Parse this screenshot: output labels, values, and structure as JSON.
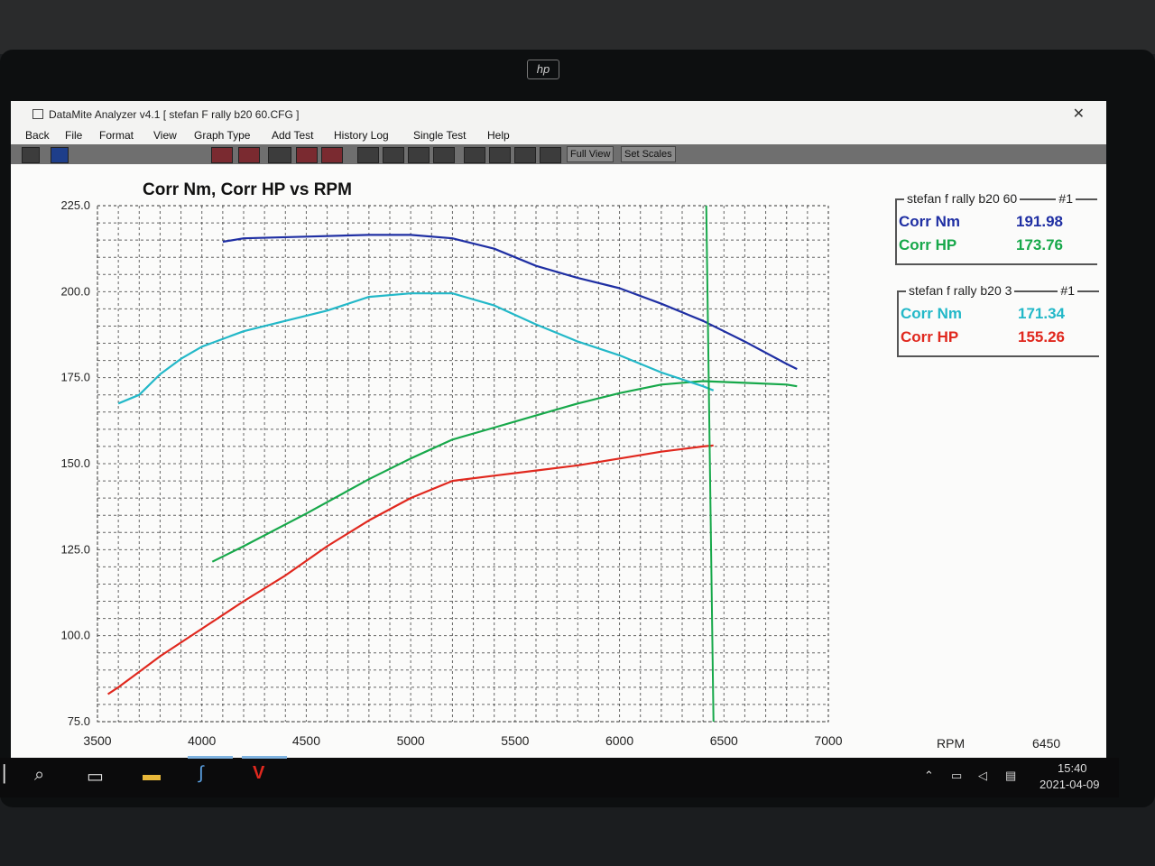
{
  "window": {
    "title": "DataMite Analyzer v4.1  [ stefan F rally b20 60.CFG ]",
    "close_glyph": "✕"
  },
  "menu": [
    "Back",
    "File",
    "Format",
    "View",
    "Graph Type",
    "Add Test",
    "History Log",
    "Single Test",
    "Help"
  ],
  "toolbar": {
    "full_view": "Full View",
    "set_scales": "Set Scales"
  },
  "legends": [
    {
      "title": "stefan f rally b20 60",
      "num": "#1",
      "rows": [
        {
          "label": "Corr Nm",
          "value": "191.98",
          "color": "#1f2fa3"
        },
        {
          "label": "Corr HP",
          "value": "173.76",
          "color": "#17a84a"
        }
      ]
    },
    {
      "title": "stefan f rally b20 3",
      "num": "#1",
      "rows": [
        {
          "label": "Corr Nm",
          "value": "171.34",
          "color": "#23b8c8"
        },
        {
          "label": "Corr HP",
          "value": "155.26",
          "color": "#e0281e"
        }
      ]
    }
  ],
  "cursor": {
    "label": "RPM",
    "value": "6450",
    "color": "#17a84a"
  },
  "taskbar": {
    "time": "15:40",
    "date": "2021-04-09"
  },
  "chart_data": {
    "type": "line",
    "title": "Corr Nm, Corr HP vs RPM",
    "xlabel": "RPM",
    "ylabel": "",
    "xlim": [
      3500,
      7000
    ],
    "ylim": [
      75,
      225
    ],
    "xticks": [
      "3500",
      "4000",
      "4500",
      "5000",
      "5500",
      "6000",
      "6500",
      "7000"
    ],
    "yticks": [
      "75.0",
      "100.0",
      "125.0",
      "150.0",
      "175.0",
      "200.0",
      "225.0"
    ],
    "grid": true,
    "series": [
      {
        "name": "Corr Nm",
        "color": "#1f2fa3",
        "x": [
          4100,
          4200,
          4500,
          4800,
          5000,
          5200,
          5400,
          5600,
          5800,
          6000,
          6200,
          6400,
          6600,
          6800,
          6850
        ],
        "y": [
          214.5,
          215.5,
          216,
          216.5,
          216.5,
          215.5,
          212.5,
          207.5,
          204,
          201,
          196.5,
          191.5,
          185.5,
          179,
          177.5
        ]
      },
      {
        "name": "Corr HP",
        "color": "#17a84a",
        "x": [
          4050,
          4200,
          4500,
          4800,
          5000,
          5200,
          5400,
          5600,
          5800,
          6000,
          6200,
          6400,
          6600,
          6800,
          6850
        ],
        "y": [
          121.5,
          126,
          135.5,
          145.5,
          151.5,
          157,
          160.5,
          164,
          167.5,
          170.5,
          173,
          174,
          173.5,
          173,
          172.5
        ]
      },
      {
        "name": "Corr Nm",
        "color": "#23b8c8",
        "x": [
          3600,
          3700,
          3800,
          3900,
          4000,
          4200,
          4400,
          4600,
          4800,
          5000,
          5200,
          5400,
          5600,
          5800,
          6000,
          6200,
          6400,
          6450
        ],
        "y": [
          167.5,
          170,
          176,
          180.5,
          184,
          188.5,
          191.5,
          194.5,
          198.5,
          199.5,
          199.5,
          196,
          190.5,
          185.5,
          181.5,
          176.5,
          172.5,
          171.3
        ]
      },
      {
        "name": "Corr HP",
        "color": "#e0281e",
        "x": [
          3550,
          3600,
          3700,
          3800,
          4000,
          4200,
          4400,
          4600,
          4800,
          5000,
          5200,
          5400,
          5600,
          5800,
          6000,
          6200,
          6400,
          6450
        ],
        "y": [
          83,
          85,
          89.5,
          94,
          102,
          110,
          117.5,
          126,
          133.5,
          140,
          145,
          146.5,
          148,
          149.5,
          151.5,
          153.5,
          155,
          155.3
        ]
      }
    ],
    "cursor_rpm": 6450
  }
}
